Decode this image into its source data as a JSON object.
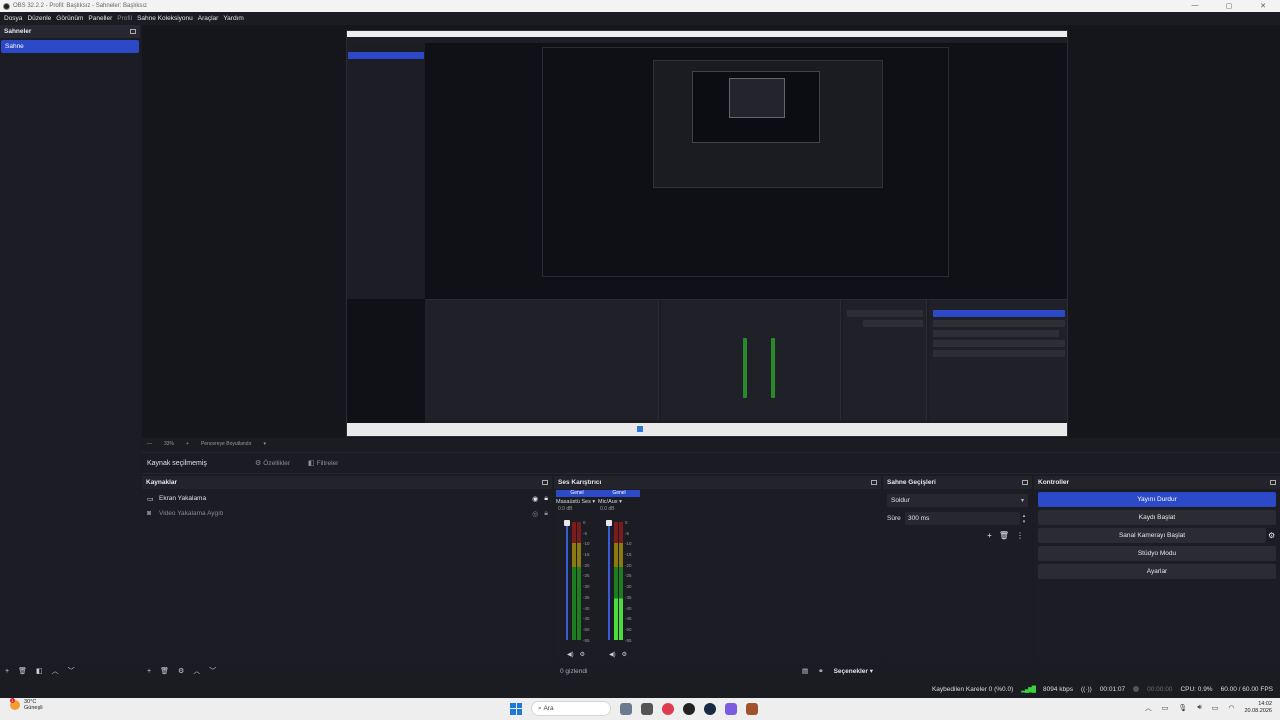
{
  "window": {
    "title": "OBS 32.2.2 - Profil: Başlıksız - Sahneler: Başlıksız",
    "controls": [
      "—",
      "▢",
      "✕"
    ]
  },
  "menu": {
    "items": [
      "Dosya",
      "Düzenle",
      "Görünüm",
      "Paneller",
      "Profil",
      "Sahne Koleksiyonu",
      "Araçlar",
      "Yardım"
    ]
  },
  "scenes": {
    "title": "Sahneler",
    "items": [
      "Sahne"
    ]
  },
  "preview_toolbar": {
    "items": [
      "—",
      "33%",
      "+",
      "Pencereye Boyutlandır",
      "▾"
    ]
  },
  "context": {
    "no_source": "Kaynak seçilmemiş",
    "properties": "Özellikler",
    "filters": "Filtreler"
  },
  "sources": {
    "title": "Kaynaklar",
    "items": [
      {
        "label": "Ekran Yakalama",
        "icon": "monitor-icon",
        "visible": true
      },
      {
        "label": "Video Yakalama Aygıtı",
        "icon": "camera-icon",
        "visible": false
      }
    ]
  },
  "mixer": {
    "title": "Ses Karıştırıcı",
    "channels": [
      {
        "tab": "Genel",
        "name": "Masaüstü Ses",
        "db": "0.0 dB",
        "level": 0.0
      },
      {
        "tab": "Genel",
        "name": "Mic/Aux",
        "db": "0.0 dB",
        "level": 0.35
      }
    ],
    "scale": [
      "0",
      "-5",
      "-10",
      "-15",
      "-20",
      "-25",
      "-30",
      "-35",
      "-40",
      "-45",
      "-50",
      "-55",
      "-60"
    ],
    "hidden": "0 gizlendi",
    "options": "Seçenekler"
  },
  "transitions": {
    "title": "Sahne Geçişleri",
    "selected": "Soldur",
    "duration_label": "Süre",
    "duration": "300 ms"
  },
  "controls": {
    "title": "Kontroller",
    "stop_stream": "Yayını Durdur",
    "start_recording": "Kaydı Başlat",
    "start_virtualcam": "Sanal Kamerayı Başlat",
    "studio_mode": "Stüdyo Modu",
    "settings": "Ayarlar"
  },
  "status": {
    "dropped": "Kaybedilen Kareler 0 (%0.0)",
    "bitrate": "8094 kbps",
    "stream_time": "00:01:07",
    "rec_time": "00:00:00",
    "cpu": "CPU: 0.9%",
    "fps": "60.00 / 60.00 FPS"
  },
  "taskbar": {
    "weather_temp": "30°C",
    "weather_desc": "Güneşli",
    "search": "Ara",
    "time": "14:02",
    "date": "20.08.2026"
  },
  "colors": {
    "accent": "#2c49c8",
    "bg": "#1b1c22",
    "meter_green": "#4bdc3e"
  }
}
